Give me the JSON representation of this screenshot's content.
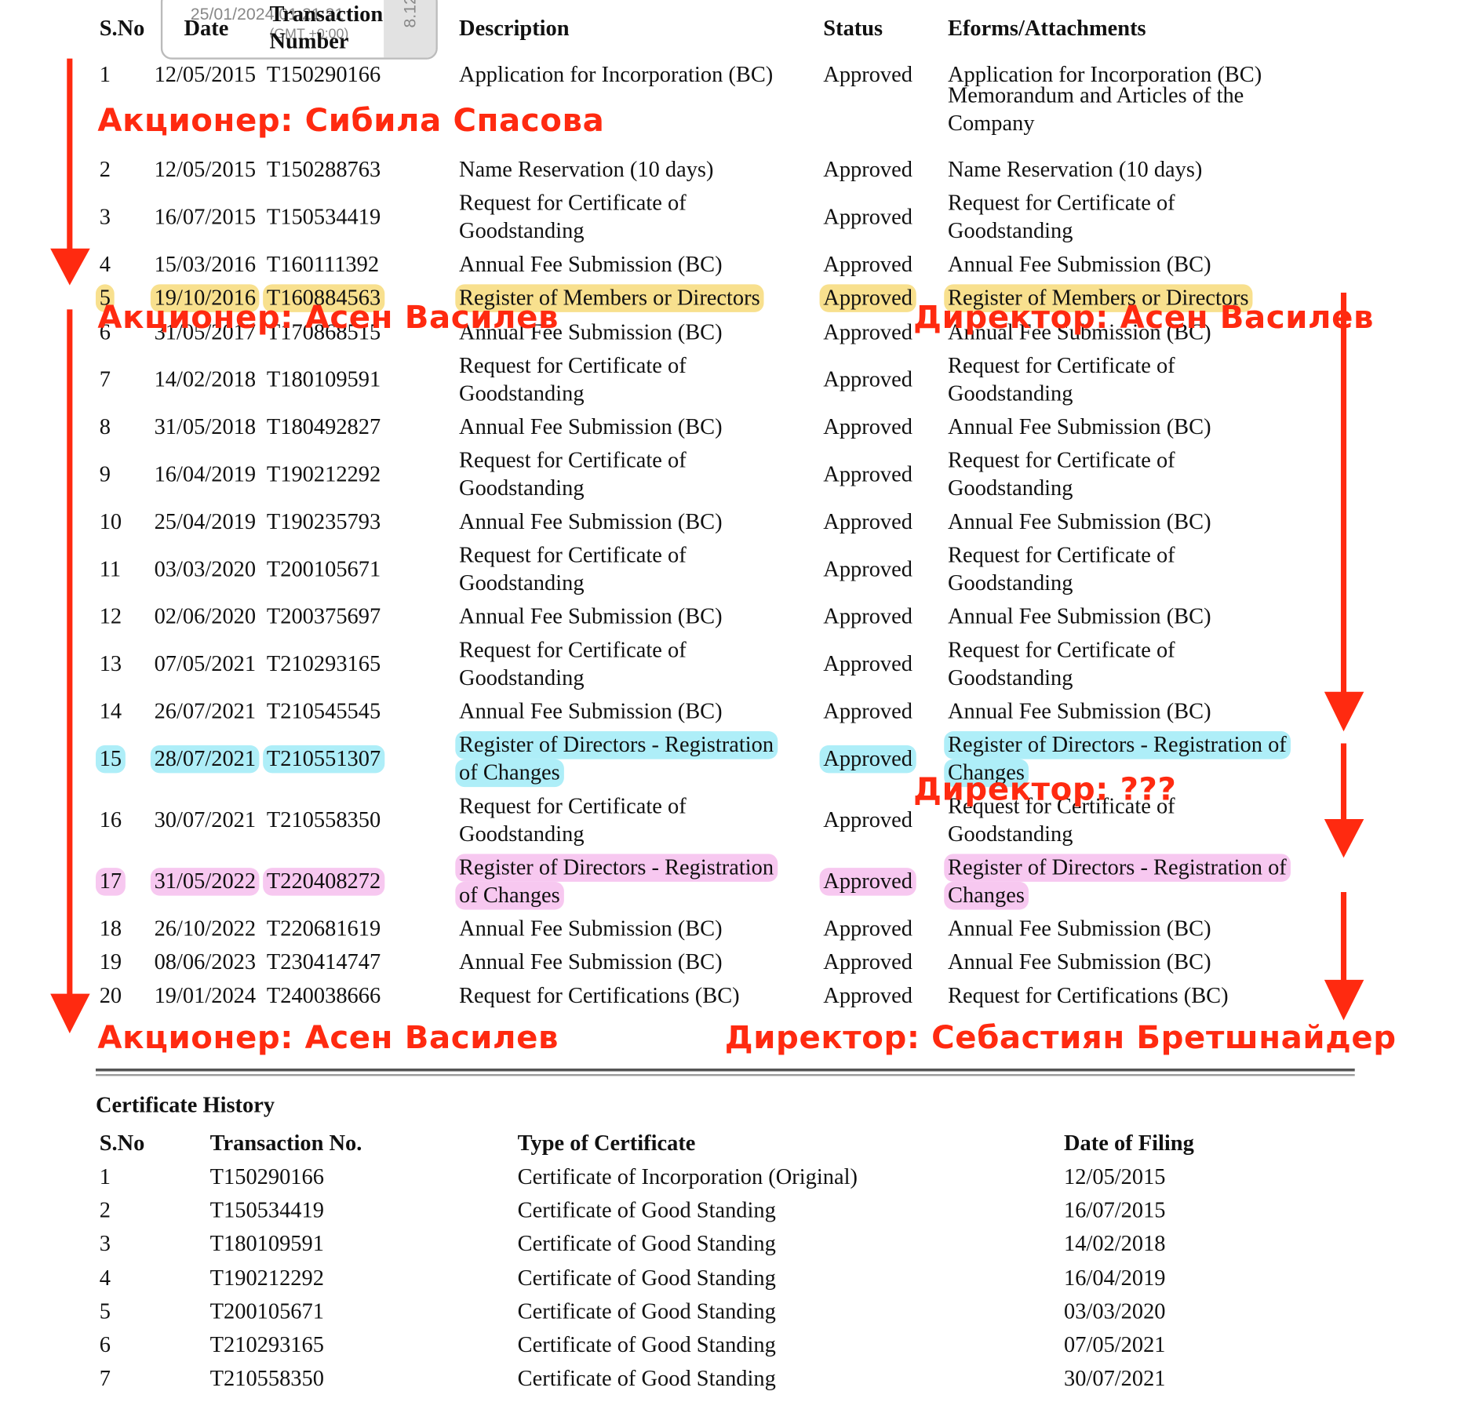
{
  "filing_history": {
    "headers": {
      "sno": "S.No",
      "date": "Date",
      "txn_line1": "Transaction",
      "txn_line2": "Number",
      "description": "Description",
      "status": "Status",
      "eforms": "Eforms/Attachments"
    },
    "rows": [
      {
        "sno": "1",
        "date": "12/05/2015",
        "txn": "T150290166",
        "desc": [
          "Application for Incorporation (BC)"
        ],
        "status": "Approved",
        "eforms": [
          "Application for Incorporation (BC)"
        ]
      },
      {
        "sno": "",
        "date": "",
        "txn": "",
        "desc": [],
        "status": "",
        "eforms": [
          "Memorandum and Articles of the",
          "Company"
        ]
      },
      {
        "sno": "2",
        "date": "12/05/2015",
        "txn": "T150288763",
        "desc": [
          "Name Reservation (10 days)"
        ],
        "status": "Approved",
        "eforms": [
          "Name Reservation (10 days)"
        ]
      },
      {
        "sno": "3",
        "date": "16/07/2015",
        "txn": "T150534419",
        "desc": [
          "Request for Certificate of",
          "Goodstanding"
        ],
        "status": "Approved",
        "eforms": [
          "Request for Certificate of",
          "Goodstanding"
        ]
      },
      {
        "sno": "4",
        "date": "15/03/2016",
        "txn": "T160111392",
        "desc": [
          "Annual Fee Submission (BC)"
        ],
        "status": "Approved",
        "eforms": [
          "Annual Fee Submission (BC)"
        ]
      },
      {
        "sno": "5",
        "date": "19/10/2016",
        "txn": "T160884563",
        "desc": [
          "Register of Members or Directors"
        ],
        "status": "Approved",
        "eforms": [
          "Register of Members or Directors"
        ],
        "highlight": "#f8e08e"
      },
      {
        "sno": "6",
        "date": "31/05/2017",
        "txn": "T170868515",
        "desc": [
          "Annual Fee Submission (BC)"
        ],
        "status": "Approved",
        "eforms": [
          "Annual Fee Submission (BC)"
        ]
      },
      {
        "sno": "7",
        "date": "14/02/2018",
        "txn": "T180109591",
        "desc": [
          "Request for Certificate of",
          "Goodstanding"
        ],
        "status": "Approved",
        "eforms": [
          "Request for Certificate of",
          "Goodstanding"
        ]
      },
      {
        "sno": "8",
        "date": "31/05/2018",
        "txn": "T180492827",
        "desc": [
          "Annual Fee Submission (BC)"
        ],
        "status": "Approved",
        "eforms": [
          "Annual Fee Submission (BC)"
        ]
      },
      {
        "sno": "9",
        "date": "16/04/2019",
        "txn": "T190212292",
        "desc": [
          "Request for Certificate of",
          "Goodstanding"
        ],
        "status": "Approved",
        "eforms": [
          "Request for Certificate of",
          "Goodstanding"
        ]
      },
      {
        "sno": "10",
        "date": "25/04/2019",
        "txn": "T190235793",
        "desc": [
          "Annual Fee Submission (BC)"
        ],
        "status": "Approved",
        "eforms": [
          "Annual Fee Submission (BC)"
        ]
      },
      {
        "sno": "11",
        "date": "03/03/2020",
        "txn": "T200105671",
        "desc": [
          "Request for Certificate of",
          "Goodstanding"
        ],
        "status": "Approved",
        "eforms": [
          "Request for Certificate of",
          "Goodstanding"
        ]
      },
      {
        "sno": "12",
        "date": "02/06/2020",
        "txn": "T200375697",
        "desc": [
          "Annual Fee Submission (BC)"
        ],
        "status": "Approved",
        "eforms": [
          "Annual Fee Submission (BC)"
        ]
      },
      {
        "sno": "13",
        "date": "07/05/2021",
        "txn": "T210293165",
        "desc": [
          "Request for Certificate of",
          "Goodstanding"
        ],
        "status": "Approved",
        "eforms": [
          "Request for Certificate of",
          "Goodstanding"
        ]
      },
      {
        "sno": "14",
        "date": "26/07/2021",
        "txn": "T210545545",
        "desc": [
          "Annual Fee Submission (BC)"
        ],
        "status": "Approved",
        "eforms": [
          "Annual Fee Submission (BC)"
        ]
      },
      {
        "sno": "15",
        "date": "28/07/2021",
        "txn": "T210551307",
        "desc": [
          "Register of Directors - Registration",
          "of Changes"
        ],
        "status": "Approved",
        "eforms": [
          "Register of Directors - Registration of",
          "Changes"
        ],
        "highlight": "#aeeef8"
      },
      {
        "sno": "16",
        "date": "30/07/2021",
        "txn": "T210558350",
        "desc": [
          "Request for Certificate of",
          "Goodstanding"
        ],
        "status": "Approved",
        "eforms": [
          "Request for Certificate of",
          "Goodstanding"
        ]
      },
      {
        "sno": "17",
        "date": "31/05/2022",
        "txn": "T220408272",
        "desc": [
          "Register of Directors - Registration",
          "of Changes"
        ],
        "status": "Approved",
        "eforms": [
          "Register of Directors - Registration of",
          "Changes"
        ],
        "highlight": "#f7c8f0"
      },
      {
        "sno": "18",
        "date": "26/10/2022",
        "txn": "T220681619",
        "desc": [
          "Annual Fee Submission (BC)"
        ],
        "status": "Approved",
        "eforms": [
          "Annual Fee Submission (BC)"
        ]
      },
      {
        "sno": "19",
        "date": "08/06/2023",
        "txn": "T230414747",
        "desc": [
          "Annual Fee Submission (BC)"
        ],
        "status": "Approved",
        "eforms": [
          "Annual Fee Submission (BC)"
        ]
      },
      {
        "sno": "20",
        "date": "19/01/2024",
        "txn": "T240038666",
        "desc": [
          "Request for Certifications (BC)"
        ],
        "status": "Approved",
        "eforms": [
          "Request for Certifications (BC)"
        ]
      }
    ]
  },
  "popup": {
    "timestamp": "25/01/2024 01:21:31",
    "timezone": "(GMT +0:00)",
    "version": "8.12"
  },
  "annotations": {
    "a1": "Акционер: Сибила Спасова",
    "a2": "Акционер: Асен Василев",
    "a3": "Директор: Асен Василев",
    "a4": "Директор: ???",
    "a5": "Акционер: Асен Василев",
    "a6": "Директор: Себастиян Бретшнайдер",
    "color": "#ff2a10"
  },
  "certificate_history": {
    "title": "Certificate History",
    "headers": {
      "sno": "S.No",
      "txn": "Transaction No.",
      "type": "Type of Certificate",
      "date": "Date of Filing"
    },
    "rows": [
      {
        "sno": "1",
        "txn": "T150290166",
        "type": "Certificate of Incorporation (Original)",
        "date": "12/05/2015"
      },
      {
        "sno": "2",
        "txn": "T150534419",
        "type": "Certificate of Good Standing",
        "date": "16/07/2015"
      },
      {
        "sno": "3",
        "txn": "T180109591",
        "type": "Certificate of Good Standing",
        "date": "14/02/2018"
      },
      {
        "sno": "4",
        "txn": "T190212292",
        "type": "Certificate of Good Standing",
        "date": "16/04/2019"
      },
      {
        "sno": "5",
        "txn": "T200105671",
        "type": "Certificate of Good Standing",
        "date": "03/03/2020"
      },
      {
        "sno": "6",
        "txn": "T210293165",
        "type": "Certificate of Good Standing",
        "date": "07/05/2021"
      },
      {
        "sno": "7",
        "txn": "T210558350",
        "type": "Certificate of Good Standing",
        "date": "30/07/2021"
      }
    ]
  }
}
